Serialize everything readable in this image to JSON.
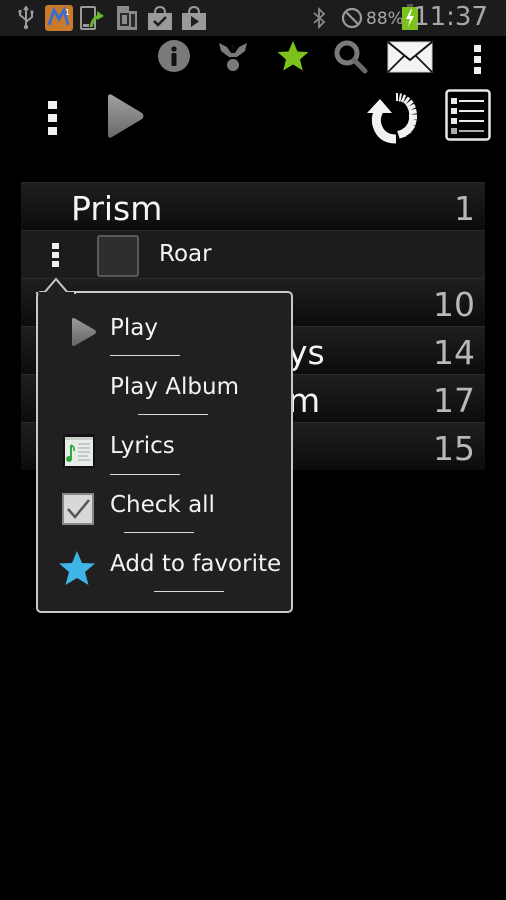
{
  "status_bar": {
    "left_icons": [
      "usb-icon",
      "market-app-icon",
      "phone-update-icon",
      "sd-card-icon",
      "shopping-bag-check-icon",
      "play-store-icon"
    ],
    "right_icons": [
      "bluetooth-icon",
      "do-not-disturb-icon",
      "battery-charging-icon"
    ],
    "battery_percent": "88%",
    "time": "11:37"
  },
  "action_bar": {
    "top_icons": [
      "info-icon",
      "share-icon",
      "favorite-star-icon",
      "search-icon",
      "mail-icon",
      "overflow-menu-icon"
    ],
    "second_row_icons": [
      "overflow-menu-icon",
      "play-icon",
      "refresh-icon",
      "list-view-icon"
    ]
  },
  "colors": {
    "accent_green": "#7cc21d",
    "favorite_blue": "#3db5e6",
    "background": "#000000",
    "popup_bg": "#202020"
  },
  "list": {
    "album": {
      "title": "Prism",
      "count": "1"
    },
    "song": {
      "title": "Roar",
      "checked": false
    },
    "rows": [
      {
        "fragment": "",
        "count": "10"
      },
      {
        "fragment": "ys",
        "count": "14"
      },
      {
        "fragment": "m",
        "count": "17"
      },
      {
        "fragment": "",
        "count": "15"
      }
    ]
  },
  "popup_menu": {
    "items": [
      {
        "label": "Play",
        "icon": "play-icon"
      },
      {
        "label": "Play Album",
        "icon": ""
      },
      {
        "label": "Lyrics",
        "icon": "lyrics-icon"
      },
      {
        "label": "Check all",
        "icon": "checkbox-checked-icon"
      },
      {
        "label": "Add to favorite",
        "icon": "star-icon"
      }
    ]
  }
}
